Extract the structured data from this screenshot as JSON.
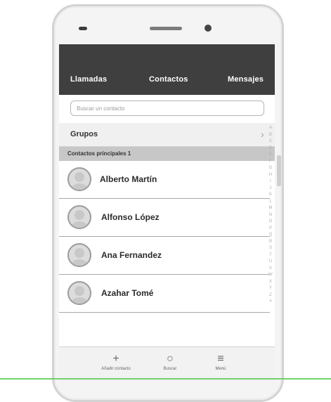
{
  "tabs": [
    "Llamadas",
    "Contactos",
    "Mensajes"
  ],
  "search": {
    "placeholder": "Buscar un contacto"
  },
  "groups": {
    "label": "Grupos"
  },
  "section": {
    "label": "Contactos principales 1"
  },
  "contacts": [
    {
      "name": "Alberto Martín"
    },
    {
      "name": "Alfonso López"
    },
    {
      "name": "Ana Fernandez"
    },
    {
      "name": "Azahar Tomé"
    }
  ],
  "index_letters": [
    "A",
    "B",
    "C",
    "D",
    "E",
    "F",
    "G",
    "H",
    "I",
    "J",
    "K",
    "L",
    "M",
    "N",
    "O",
    "P",
    "Q",
    "R",
    "S",
    "T",
    "U",
    "V",
    "W",
    "X",
    "Y",
    "Z",
    "#"
  ],
  "bottom_nav": [
    {
      "icon": "plus-icon",
      "glyph": "+",
      "label": "Añadir contacto"
    },
    {
      "icon": "search-icon",
      "glyph": "○",
      "label": "Buscar"
    },
    {
      "icon": "menu-icon",
      "glyph": "≡",
      "label": "Menú"
    }
  ],
  "colors": {
    "topbar": "#3f3f3f",
    "section": "#c7c7c7",
    "accent": "#6fd26f"
  }
}
